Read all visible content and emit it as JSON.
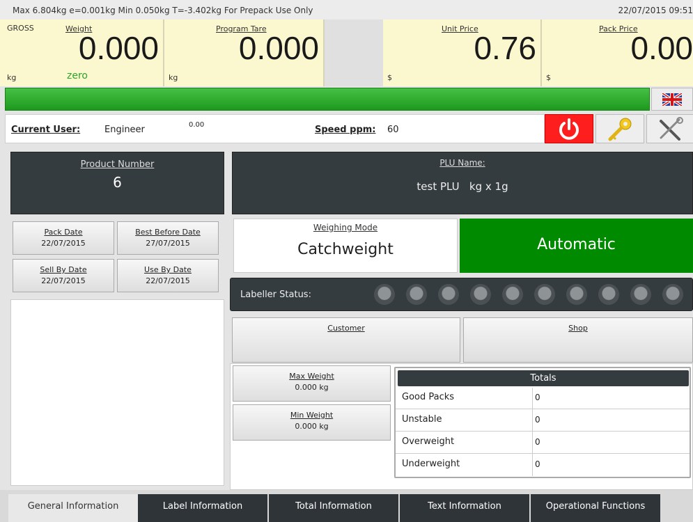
{
  "status": {
    "spec": "Max 6.804kg  e=0.001kg  Min 0.050kg  T=-3.402kg For Prepack Use Only",
    "datetime": "22/07/2015 09:51"
  },
  "displays": {
    "gross_label": "GROSS",
    "weight_label": "Weight",
    "weight_value": "0.000",
    "weight_unit": "kg",
    "zero_label": "zero",
    "tare_label": "Program Tare",
    "tare_value": "0.000",
    "tare_unit": "kg",
    "unit_price_label": "Unit Price",
    "unit_price_value": "0.76",
    "unit_price_unit": "$",
    "pack_price_label": "Pack Price",
    "pack_price_value": "0.00",
    "pack_price_unit": "$"
  },
  "user": {
    "current_user_label": "Current User:",
    "current_user_value": "Engineer",
    "value_small": "0.00",
    "speed_label": "Speed ppm:",
    "speed_value": "60"
  },
  "product": {
    "label": "Product Number",
    "value": "6"
  },
  "dates": [
    {
      "label": "Pack Date",
      "value": "22/07/2015"
    },
    {
      "label": "Best Before Date",
      "value": "27/07/2015"
    },
    {
      "label": "Sell By Date",
      "value": "22/07/2015"
    },
    {
      "label": "Use By Date",
      "value": "22/07/2015"
    }
  ],
  "plu": {
    "label": "PLU Name:",
    "value": "test PLU   kg x 1g"
  },
  "weighing": {
    "label": "Weighing Mode",
    "value": "Catchweight",
    "mode_button": "Automatic"
  },
  "labeller": {
    "label": "Labeller Status:"
  },
  "customer_label": "Customer",
  "shop_label": "Shop",
  "limits": [
    {
      "label": "Max Weight",
      "value": "0.000 kg"
    },
    {
      "label": "Min Weight",
      "value": "0.000 kg"
    }
  ],
  "totals": {
    "title": "Totals",
    "rows": [
      {
        "name": "Good Packs",
        "value": "0"
      },
      {
        "name": "Unstable",
        "value": "0"
      },
      {
        "name": "Overweight",
        "value": "0"
      },
      {
        "name": "Underweight",
        "value": "0"
      }
    ]
  },
  "tabs": [
    "General Information",
    "Label Information",
    "Total Information",
    "Text Information",
    "Operational Functions"
  ],
  "colors": {
    "display_bg": "#fbf7cf",
    "progress_green": "#2fae2f",
    "automatic_green": "#008a00",
    "power_red": "#ff1e1e",
    "dark_panel": "#353c40"
  },
  "icons": [
    "uk-flag-icon",
    "power-icon",
    "key-icon",
    "tools-icon"
  ]
}
